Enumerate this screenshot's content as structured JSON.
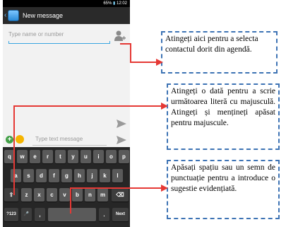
{
  "status_bar": {
    "battery": "65%",
    "time": "12:02"
  },
  "action_bar": {
    "title": "New message",
    "back_icon": "back-chevron-icon",
    "app_icon": "messaging-app-icon"
  },
  "recipient": {
    "placeholder": "Type name or number",
    "contact_icon": "add-contact-icon"
  },
  "compose": {
    "placeholder": "Type text message",
    "attach_icon": "attach-plus-icon",
    "emoji_icon": "smiley-icon",
    "send_icon": "send-arrow-icon"
  },
  "keyboard": {
    "row1": [
      "q",
      "w",
      "e",
      "r",
      "t",
      "y",
      "u",
      "i",
      "o",
      "p"
    ],
    "row2": [
      "a",
      "s",
      "d",
      "f",
      "g",
      "h",
      "j",
      "k",
      "l"
    ],
    "row3": [
      "⇧",
      "z",
      "x",
      "c",
      "v",
      "b",
      "n",
      "m",
      "⌫"
    ],
    "row4": [
      "?123",
      "🎤",
      ",",
      "",
      ".",
      "Next"
    ]
  },
  "callouts": {
    "contact": "Atingeți aici pentru a selecta contactul dorit din agendă.",
    "shift": "Atingeți o dată pentru a scrie următoarea literă cu majusculă. Atingeți și mențineți apăsat pentru majuscule.",
    "space": "Apăsați spațiu sau un semn de punctuație pentru a introduce o sugestie evidențiată."
  },
  "colors": {
    "callout_border": "#3d73b4",
    "arrow": "#e53935",
    "accent": "#3aa6e0"
  }
}
